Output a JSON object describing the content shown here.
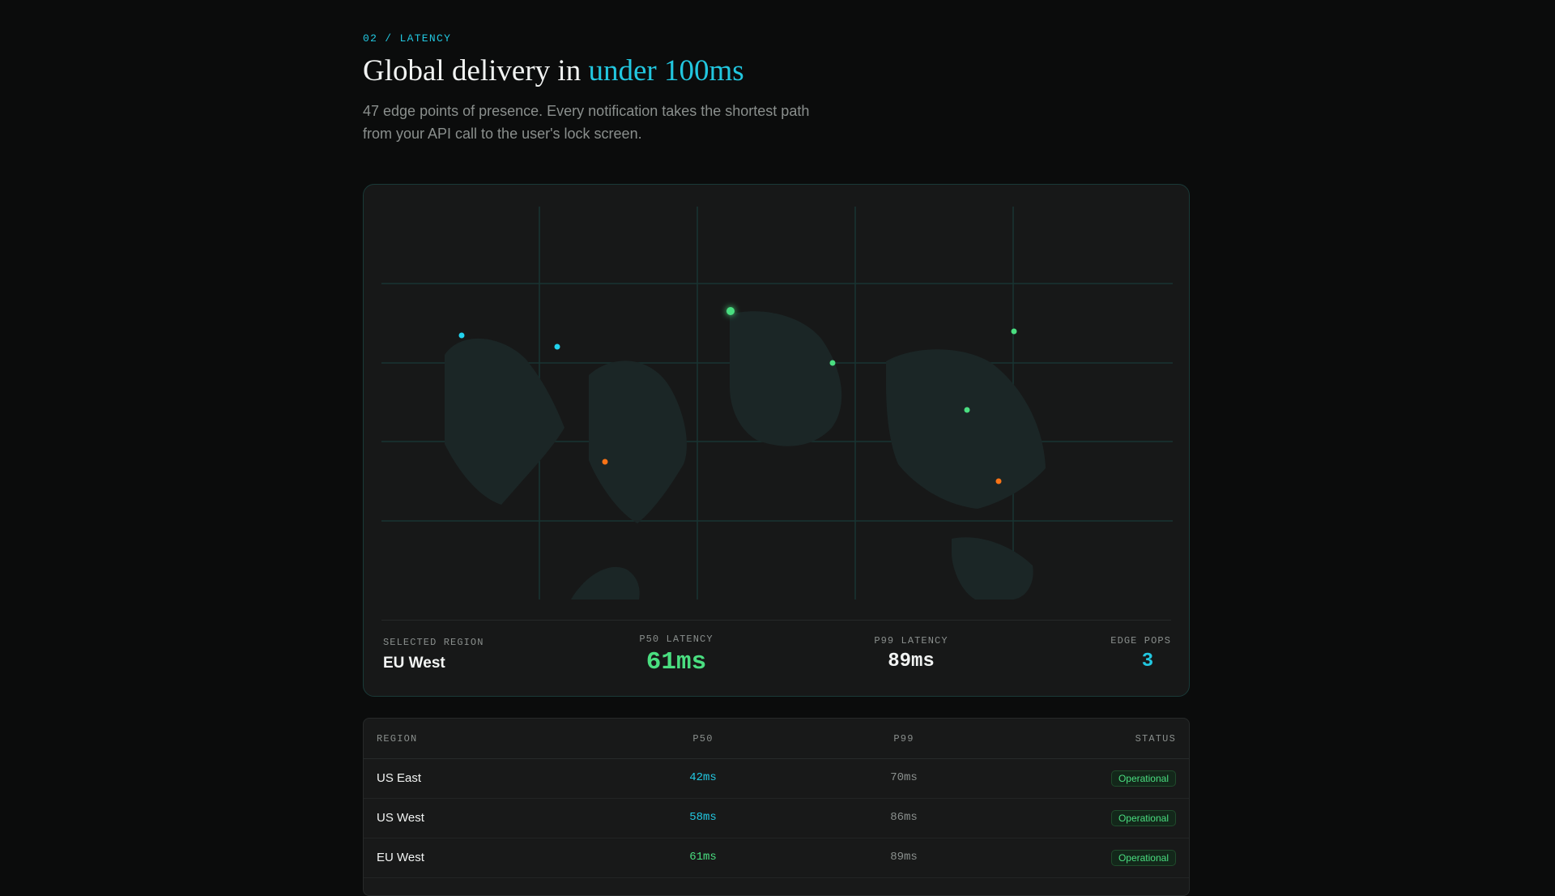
{
  "header": {
    "eyebrow": "02 / LATENCY",
    "title_prefix": "Global delivery in ",
    "title_accent": "under 100ms",
    "subtitle": "47 edge points of presence. Every notification takes the shortest path from your API call to the user's lock screen."
  },
  "colors": {
    "accent_cyan": "#22c7e0",
    "accent_green": "#4ade80",
    "accent_orange": "#f97316",
    "background": "#0b0c0c",
    "card": "#171818"
  },
  "map": {
    "points": [
      {
        "region": "US West",
        "color": "cyan"
      },
      {
        "region": "US East",
        "color": "cyan"
      },
      {
        "region": "South America",
        "color": "orange"
      },
      {
        "region": "EU West",
        "color": "green",
        "selected": true
      },
      {
        "region": "EU Central",
        "color": "green"
      },
      {
        "region": "Asia North",
        "color": "green"
      },
      {
        "region": "Asia South",
        "color": "green"
      },
      {
        "region": "Asia Pacific",
        "color": "orange"
      }
    ]
  },
  "stats": {
    "selected_region_label": "SELECTED REGION",
    "selected_region_value": "EU West",
    "p50_label": "P50 LATENCY",
    "p50_value": "61ms",
    "p99_label": "P99 LATENCY",
    "p99_value": "89ms",
    "edge_pops_label": "EDGE POPS",
    "edge_pops_value": "3"
  },
  "table": {
    "columns": {
      "region": "REGION",
      "p50": "P50",
      "p99": "P99",
      "status": "STATUS"
    },
    "rows": [
      {
        "region": "US East",
        "p50": "42ms",
        "p99": "70ms",
        "status": "Operational",
        "p50_color": "#22c7e0"
      },
      {
        "region": "US West",
        "p50": "58ms",
        "p99": "86ms",
        "status": "Operational",
        "p50_color": "#22c7e0"
      },
      {
        "region": "EU West",
        "p50": "61ms",
        "p99": "89ms",
        "status": "Operational",
        "p50_color": "#4ade80"
      }
    ]
  }
}
